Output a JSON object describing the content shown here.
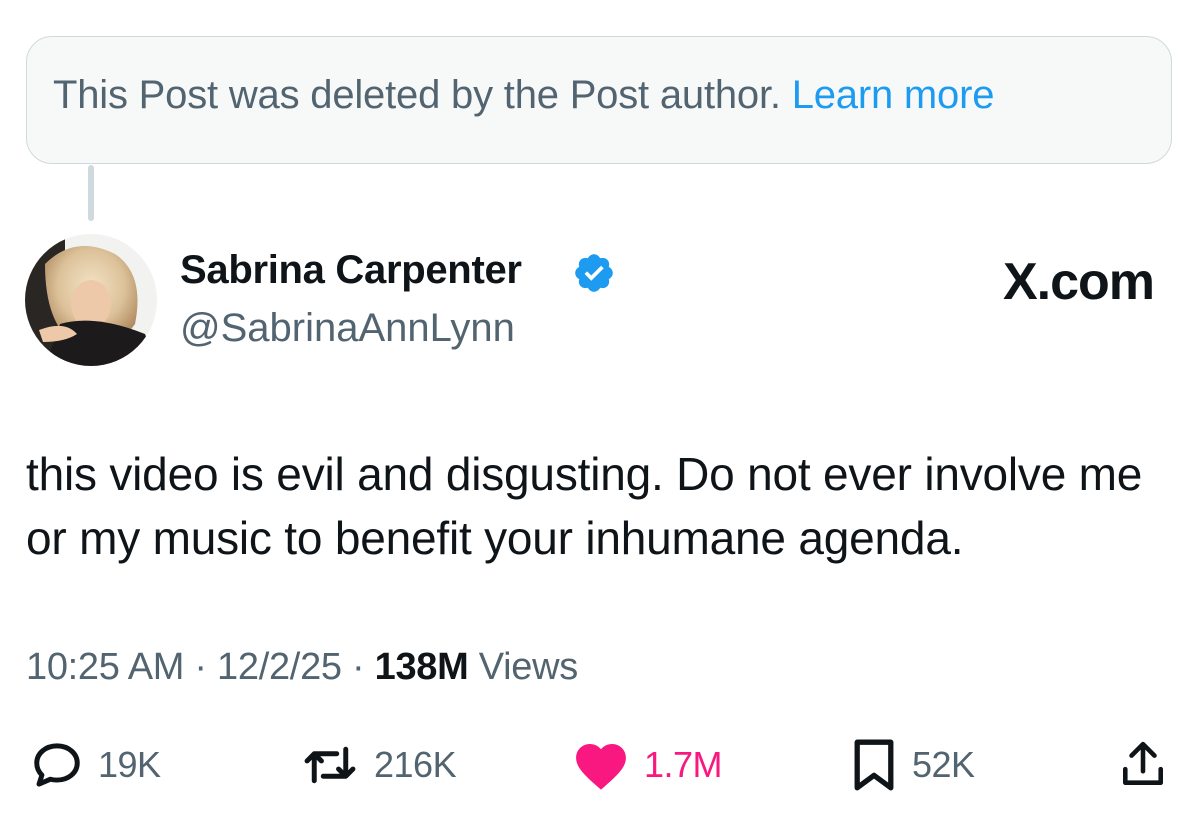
{
  "deleted_notice": {
    "text": "This Post was deleted by the Post author.",
    "link": "Learn more"
  },
  "author": {
    "display_name": "Sabrina Carpenter",
    "handle": "@SabrinaAnnLynn",
    "verified": true
  },
  "branding": {
    "logo_text": "X.com"
  },
  "post": {
    "text": "this video is evil and disgusting. Do not ever involve me or my music to benefit your inhumane agenda."
  },
  "meta": {
    "time": "10:25 AM",
    "date": "12/2/25",
    "separator": "·",
    "views_count": "138M",
    "views_label": "Views"
  },
  "actions": {
    "replies": "19K",
    "reposts": "216K",
    "likes": "1.7M",
    "bookmarks": "52K"
  },
  "colors": {
    "accent": "#1d9bf0",
    "like": "#f91880",
    "secondary_text": "#536471",
    "primary_text": "#0f1419"
  },
  "icons": [
    "reply-icon",
    "repost-icon",
    "like-icon",
    "bookmark-icon",
    "share-icon",
    "verified-badge-icon"
  ]
}
